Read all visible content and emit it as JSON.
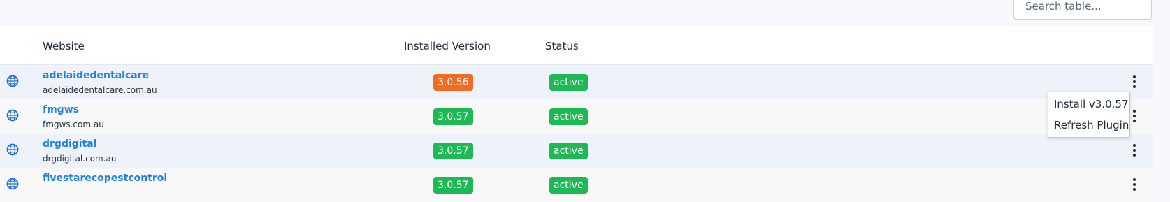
{
  "search": {
    "placeholder": "Search table..."
  },
  "table": {
    "headers": {
      "website": "Website",
      "installed_version": "Installed Version",
      "status": "Status"
    },
    "rows": [
      {
        "name": "adelaidedentalcare",
        "domain": "adelaidedentalcare.com.au",
        "version": "3.0.56",
        "version_color": "#f26b21",
        "status": "active"
      },
      {
        "name": "fmgws",
        "domain": "fmgws.com.au",
        "version": "3.0.57",
        "version_color": "#1db954",
        "status": "active"
      },
      {
        "name": "drgdigital",
        "domain": "drgdigital.com.au",
        "version": "3.0.57",
        "version_color": "#1db954",
        "status": "active"
      },
      {
        "name": "fivestarecopestcontrol",
        "domain": "",
        "version": "3.0.57",
        "version_color": "#1db954",
        "status": "active"
      }
    ]
  },
  "context_menu": {
    "items": [
      "Install v3.0.57",
      "Refresh Plugin"
    ]
  },
  "colors": {
    "link": "#1e80e6",
    "active": "#1db954",
    "outdated": "#f26b21"
  }
}
